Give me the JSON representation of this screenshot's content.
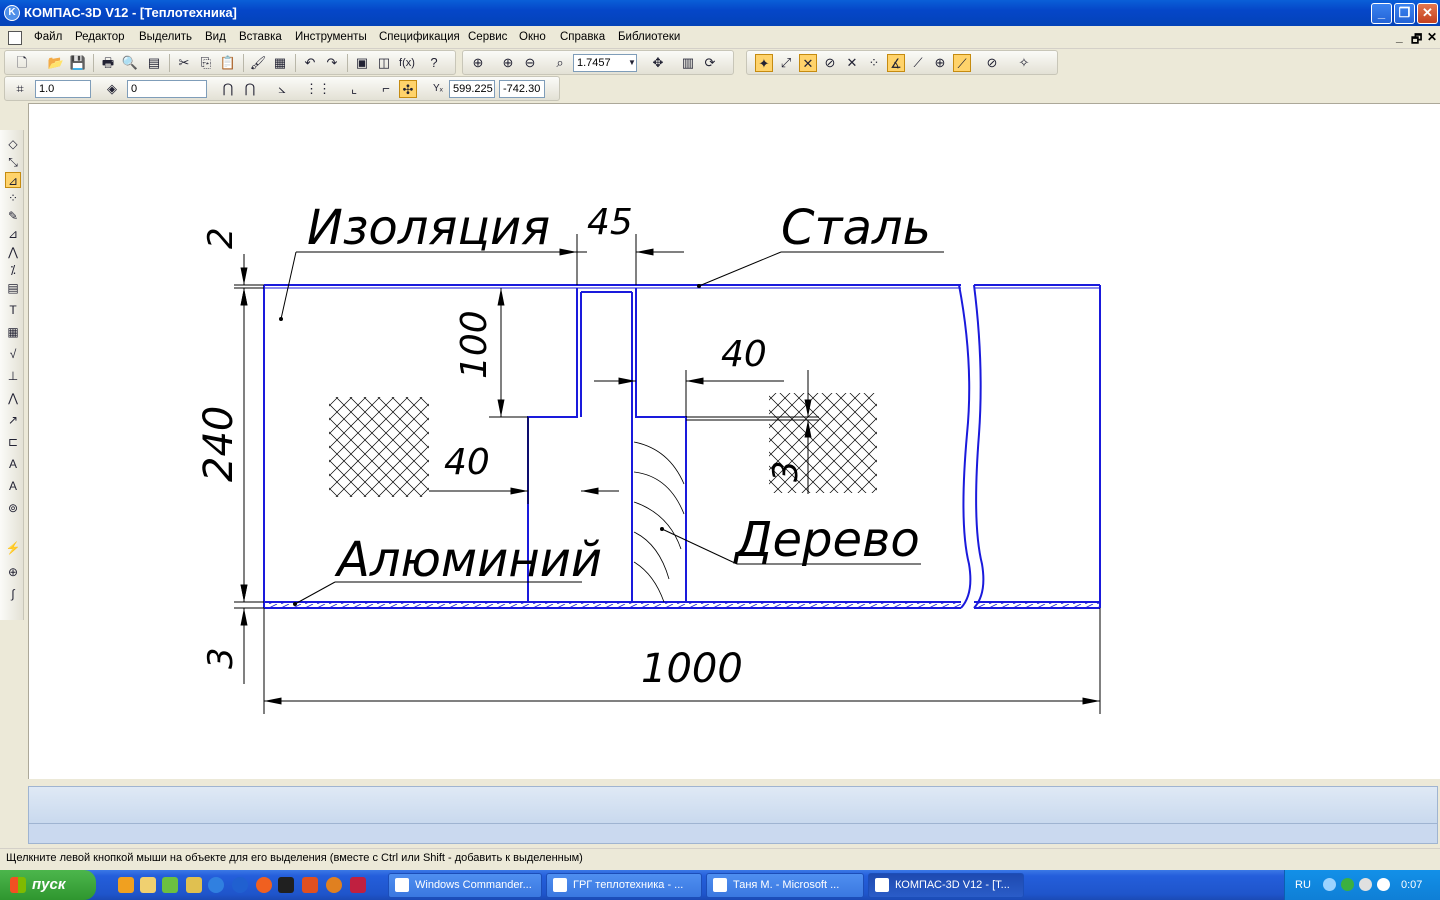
{
  "window": {
    "title": "КОМПАС-3D V12 - [Теплотехника]",
    "logo_glyph": "K",
    "buttons": [
      "_",
      "❐",
      "✕"
    ]
  },
  "menu": {
    "items": [
      "Файл",
      "Редактор",
      "Выделить",
      "Вид",
      "Вставка",
      "Инструменты",
      "Спецификация",
      "Сервис",
      "Окно",
      "Справка",
      "Библиотеки"
    ],
    "mdi": [
      "_",
      "🗗",
      "✕"
    ]
  },
  "toolbar": {
    "zoom_value": "1.7457",
    "step_value": "1.0",
    "layer_value": "0",
    "coord_x": "599.225",
    "coord_y": "-742.30",
    "fx_label": "f(x)",
    "xy_label": "Yₓ"
  },
  "drawing": {
    "labels": {
      "insulation": "Изоляция",
      "steel": "Сталь",
      "aluminum": "Алюминий",
      "wood": "Дерево"
    },
    "dimensions": {
      "d2": "2",
      "d45": "45",
      "d100": "100",
      "d40_right": "40",
      "d40_left": "40",
      "d3_inner": "3",
      "d240": "240",
      "d3_bottom": "3",
      "d1000": "1000"
    }
  },
  "status": {
    "hint": "Щелкните левой кнопкой мыши на объекте для его выделения (вместе с Ctrl или Shift - добавить к выделенным)"
  },
  "taskbar": {
    "start_label": "пуск",
    "tasks": [
      {
        "label": "Windows Commander...",
        "active": false
      },
      {
        "label": "ГРГ теплотехника - ...",
        "active": false
      },
      {
        "label": "Таня М. - Microsoft ...",
        "active": false
      },
      {
        "label": "КОМПАС-3D V12 - [Т...",
        "active": true
      }
    ],
    "language": "RU",
    "clock": "0:07"
  },
  "colors": {
    "titlebar": "#0546c8",
    "drawing_blue": "#1a1adc",
    "taskbar": "#245edb",
    "start_green": "#2f962f"
  }
}
